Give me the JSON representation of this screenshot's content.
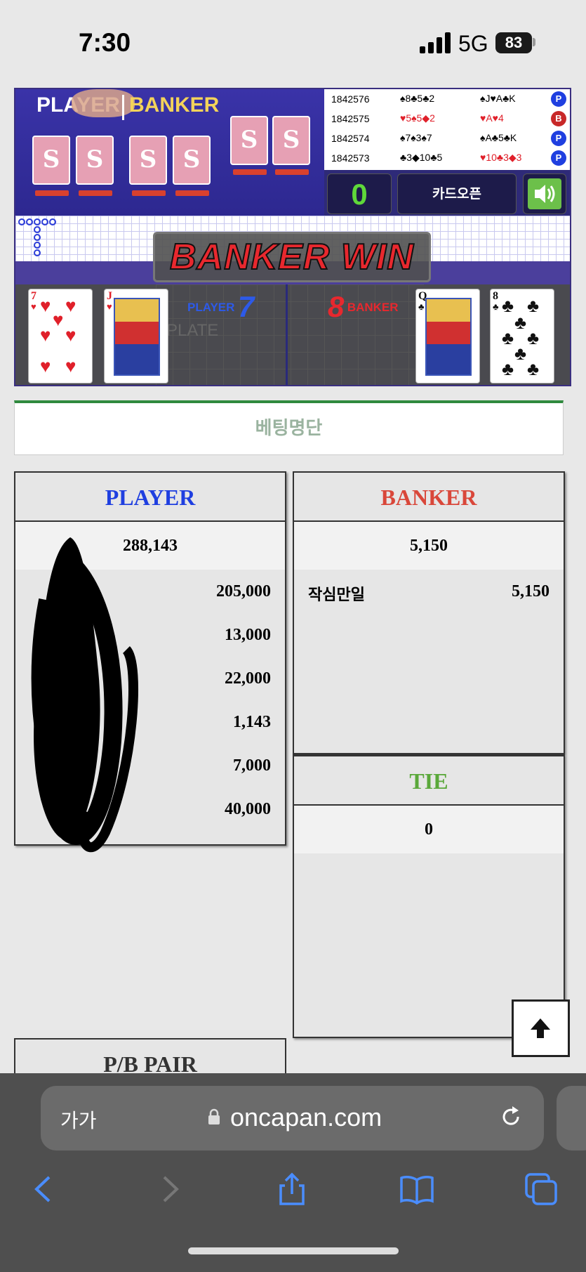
{
  "status_bar": {
    "time": "7:30",
    "network": "5G",
    "battery": "83"
  },
  "game": {
    "live_labels": {
      "player": "PLAYER",
      "banker": "BANKER"
    },
    "history": [
      {
        "round": "1842576",
        "player_cards": "♠8♣5♣2",
        "banker_cards": "♠J♥A♣K",
        "result": "P"
      },
      {
        "round": "1842575",
        "player_cards": "♥5♠5◆2",
        "banker_cards": "♥A♥4",
        "result": "B"
      },
      {
        "round": "1842574",
        "player_cards": "♠7♠3♠7",
        "banker_cards": "♠A♣5♣K",
        "result": "P"
      },
      {
        "round": "1842573",
        "player_cards": "♣3◆10♣5",
        "banker_cards": "♥10♣3◆3",
        "result": "P"
      }
    ],
    "counter": "0",
    "card_open_label": "카드오픈",
    "win_banner": "BANKER WIN",
    "player_score_label": "PLAYER",
    "player_score": "7",
    "banker_score_label": "BANKER",
    "banker_score": "8",
    "ghost_text": "PLATE",
    "player_cards": [
      {
        "rank": "7",
        "suit": "♥"
      },
      {
        "rank": "J",
        "suit": "♥"
      }
    ],
    "banker_cards": [
      {
        "rank": "Q",
        "suit": "♣"
      },
      {
        "rank": "8",
        "suit": "♣"
      }
    ]
  },
  "bet_list_title": "베팅명단",
  "player_panel": {
    "header": "PLAYER",
    "total": "288,143",
    "rows": [
      {
        "name": "",
        "amount": "205,000"
      },
      {
        "name": "",
        "amount": "13,000"
      },
      {
        "name": "",
        "amount": "22,000"
      },
      {
        "name": "",
        "amount": "1,143"
      },
      {
        "name": "",
        "amount": "7,000"
      },
      {
        "name": "",
        "amount": "40,000"
      }
    ]
  },
  "banker_panel": {
    "header": "BANKER",
    "total": "5,150",
    "rows": [
      {
        "name": "작심만일",
        "amount": "5,150"
      }
    ]
  },
  "tie_panel": {
    "header": "TIE",
    "total": "0"
  },
  "pair_panel": {
    "header": "P/B PAIR"
  },
  "browser": {
    "aa_label": "가가",
    "url": "oncapan.com"
  },
  "colors": {
    "player": "#1f3fe0",
    "banker": "#d9473a",
    "tie": "#5aa83a",
    "accent_green": "#2f8a3e"
  }
}
